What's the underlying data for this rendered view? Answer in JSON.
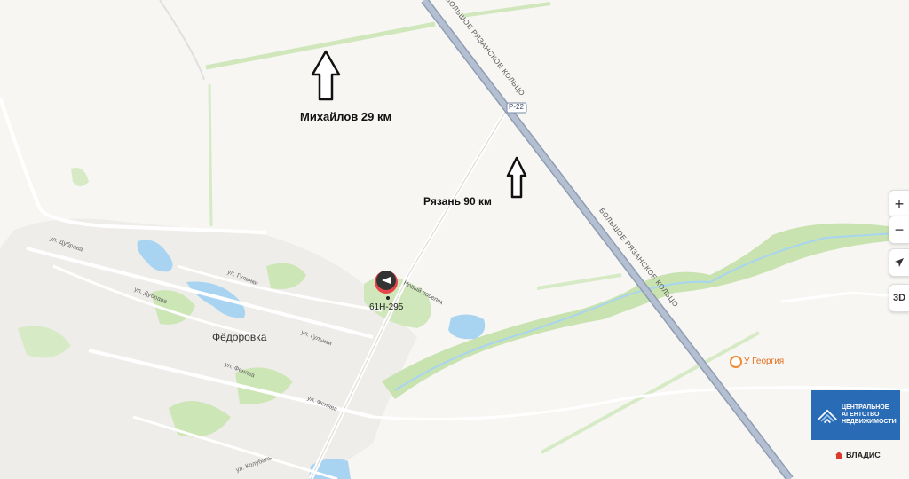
{
  "annotations": {
    "mikhailov": "Михайлов 29 км",
    "ryazan": "Рязань 90 км"
  },
  "places": {
    "village": "Фёдоровка",
    "poi": "У Георгия",
    "settlement": "Новый поселок",
    "marker_label": "61Н-295"
  },
  "roads": {
    "ring_top": "БОЛЬШОЕ РЯЗАНСКОЕ КОЛЬЦО",
    "ring_mid": "БОЛЬШОЕ РЯЗАНСКОЕ КОЛЬЦО",
    "route_badge": "Р-22"
  },
  "streets": {
    "dubrava1": "ул. Дубрава",
    "dubrava2": "ул. Дубрава",
    "gulyanki1": "ул. Гульнки",
    "gulyanki2": "ул. Гульнки",
    "fenyava1": "ул. Фенява",
    "fenyava2": "ул. Фенява",
    "kolubal": "ул. Колубаль"
  },
  "controls": {
    "zoom_in": "+",
    "zoom_out": "−",
    "mode_3d": "3D"
  },
  "branding": {
    "agency": "ЦЕНТРАЛЬНОЕ АГЕНТСТВО НЕДВИЖИМОСТИ",
    "vladis": "ВЛАДИС"
  },
  "colors": {
    "background": "#f7f6f3",
    "green": "#c8e3b0",
    "water": "#a8d4f2",
    "highway": "#a7b4c8",
    "agency_blue": "#2a6bb5",
    "vladis_red": "#d93a2b"
  }
}
